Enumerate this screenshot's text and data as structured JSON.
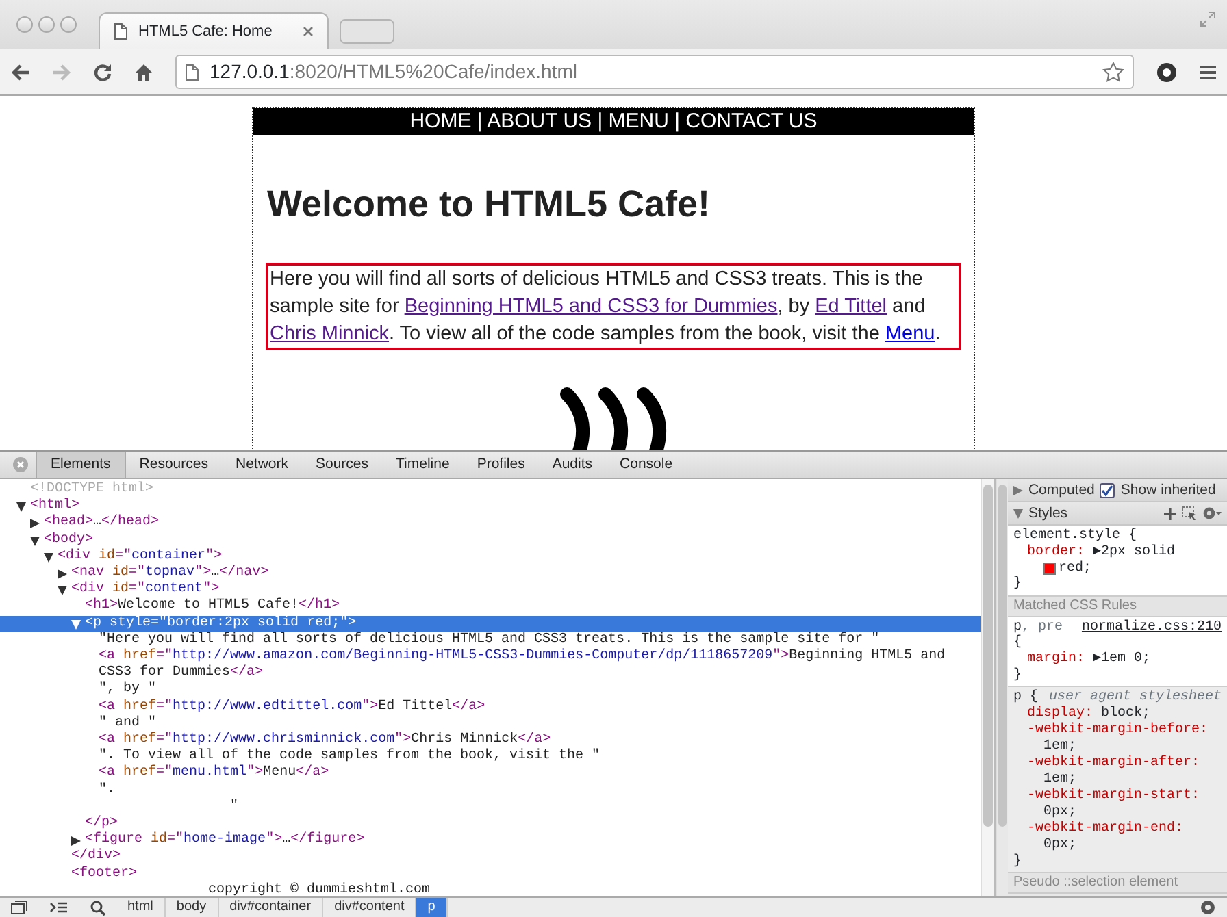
{
  "window": {
    "tab_title": "HTML5 Cafe: Home",
    "nav_buttons": [
      {
        "kind": "back",
        "disabled": false
      },
      {
        "kind": "forward",
        "disabled": true
      }
    ],
    "url_host": "127.0.0.1",
    "url_path": ":8020/HTML5%20Cafe/index.html"
  },
  "page": {
    "nav": "HOME | ABOUT US | MENU | CONTACT US",
    "heading": "Welcome to HTML5 Cafe!",
    "paragraph": [
      {
        "kind": "text",
        "text": "Here you will find all sorts of delicious HTML5 and CSS3 treats. This is the sample site for "
      },
      {
        "kind": "link",
        "text": "Beginning HTML5 and CSS3 for Dummies",
        "visited": true
      },
      {
        "kind": "text",
        "text": ", by "
      },
      {
        "kind": "link",
        "text": "Ed Tittel",
        "visited": true
      },
      {
        "kind": "text",
        "text": " and "
      },
      {
        "kind": "link",
        "text": "Chris Minnick",
        "visited": true
      },
      {
        "kind": "text",
        "text": ". To view all of the code samples from the book, visit the "
      },
      {
        "kind": "link",
        "text": "Menu",
        "visited": false
      },
      {
        "kind": "text",
        "text": "."
      }
    ]
  },
  "devtools": {
    "tabs": [
      {
        "label": "Elements",
        "selected": true
      },
      {
        "label": "Resources",
        "selected": false
      },
      {
        "label": "Network",
        "selected": false
      },
      {
        "label": "Sources",
        "selected": false
      },
      {
        "label": "Timeline",
        "selected": false
      },
      {
        "label": "Profiles",
        "selected": false
      },
      {
        "label": "Audits",
        "selected": false
      },
      {
        "label": "Console",
        "selected": false
      }
    ],
    "dom": [
      {
        "parts": [
          {
            "kind": "doctype",
            "text": "<!DOCTYPE html>"
          }
        ],
        "selected": false
      },
      {
        "parts": [
          {
            "kind": "tag",
            "text": "<html>"
          }
        ],
        "expanded": true,
        "selected": false,
        "children": [
          {
            "parts": [
              {
                "kind": "tag",
                "text": "<head>"
              },
              {
                "kind": "text",
                "text": "…"
              },
              {
                "kind": "tag",
                "text": "</head>"
              }
            ],
            "expanded": false,
            "selected": false
          },
          {
            "parts": [
              {
                "kind": "tag",
                "text": "<body>"
              }
            ],
            "expanded": true,
            "selected": false,
            "children": [
              {
                "parts": [
                  {
                    "kind": "tag",
                    "text": "<div "
                  },
                  {
                    "kind": "attr",
                    "text": "id"
                  },
                  {
                    "kind": "tag",
                    "text": "=\""
                  },
                  {
                    "kind": "value",
                    "text": "container"
                  },
                  {
                    "kind": "tag",
                    "text": "\">"
                  }
                ],
                "expanded": true,
                "selected": false,
                "children": [
                  {
                    "parts": [
                      {
                        "kind": "tag",
                        "text": "<nav "
                      },
                      {
                        "kind": "attr",
                        "text": "id"
                      },
                      {
                        "kind": "tag",
                        "text": "=\""
                      },
                      {
                        "kind": "value",
                        "text": "topnav"
                      },
                      {
                        "kind": "tag",
                        "text": "\">"
                      },
                      {
                        "kind": "text",
                        "text": "…"
                      },
                      {
                        "kind": "tag",
                        "text": "</nav>"
                      }
                    ],
                    "expanded": false,
                    "selected": false
                  },
                  {
                    "parts": [
                      {
                        "kind": "tag",
                        "text": "<div "
                      },
                      {
                        "kind": "attr",
                        "text": "id"
                      },
                      {
                        "kind": "tag",
                        "text": "=\""
                      },
                      {
                        "kind": "value",
                        "text": "content"
                      },
                      {
                        "kind": "tag",
                        "text": "\">"
                      }
                    ],
                    "expanded": true,
                    "selected": false,
                    "children": [
                      {
                        "parts": [
                          {
                            "kind": "tag",
                            "text": "<h1>"
                          },
                          {
                            "kind": "text",
                            "text": "Welcome to HTML5 Cafe!"
                          },
                          {
                            "kind": "tag",
                            "text": "</h1>"
                          }
                        ],
                        "selected": false
                      },
                      {
                        "parts": [
                          {
                            "kind": "tag",
                            "text": "<p "
                          },
                          {
                            "kind": "attr",
                            "text": "style"
                          },
                          {
                            "kind": "tag",
                            "text": "=\""
                          },
                          {
                            "kind": "value",
                            "text": "border:2px solid red;"
                          },
                          {
                            "kind": "tag",
                            "text": "\">"
                          }
                        ],
                        "expanded": true,
                        "selected": true,
                        "children": [
                          {
                            "parts": [
                              {
                                "kind": "text",
                                "text": "\"Here you will find all sorts of delicious HTML5 and CSS3 treats. This is the sample site for \""
                              }
                            ],
                            "selected": false
                          },
                          {
                            "parts": [
                              {
                                "kind": "tag",
                                "text": "<a "
                              },
                              {
                                "kind": "attr",
                                "text": "href"
                              },
                              {
                                "kind": "tag",
                                "text": "=\""
                              },
                              {
                                "kind": "value",
                                "text": "http://www.amazon.com/Beginning-HTML5-CSS3-Dummies-Computer/dp/1118657209"
                              },
                              {
                                "kind": "tag",
                                "text": "\">"
                              },
                              {
                                "kind": "text",
                                "text": "Beginning HTML5 and CSS3 for Dummies"
                              },
                              {
                                "kind": "tag",
                                "text": "</a>"
                              }
                            ],
                            "selected": false
                          },
                          {
                            "parts": [
                              {
                                "kind": "text",
                                "text": "\", by \""
                              }
                            ],
                            "selected": false
                          },
                          {
                            "parts": [
                              {
                                "kind": "tag",
                                "text": "<a "
                              },
                              {
                                "kind": "attr",
                                "text": "href"
                              },
                              {
                                "kind": "tag",
                                "text": "=\""
                              },
                              {
                                "kind": "value",
                                "text": "http://www.edtittel.com"
                              },
                              {
                                "kind": "tag",
                                "text": "\">"
                              },
                              {
                                "kind": "text",
                                "text": "Ed Tittel"
                              },
                              {
                                "kind": "tag",
                                "text": "</a>"
                              }
                            ],
                            "selected": false
                          },
                          {
                            "parts": [
                              {
                                "kind": "text",
                                "text": "\" and \""
                              }
                            ],
                            "selected": false
                          },
                          {
                            "parts": [
                              {
                                "kind": "tag",
                                "text": "<a "
                              },
                              {
                                "kind": "attr",
                                "text": "href"
                              },
                              {
                                "kind": "tag",
                                "text": "=\""
                              },
                              {
                                "kind": "value",
                                "text": "http://www.chrisminnick.com"
                              },
                              {
                                "kind": "tag",
                                "text": "\">"
                              },
                              {
                                "kind": "text",
                                "text": "Chris Minnick"
                              },
                              {
                                "kind": "tag",
                                "text": "</a>"
                              }
                            ],
                            "selected": false
                          },
                          {
                            "parts": [
                              {
                                "kind": "text",
                                "text": "\". To view all of the code samples from the book, visit the \""
                              }
                            ],
                            "selected": false
                          },
                          {
                            "parts": [
                              {
                                "kind": "tag",
                                "text": "<a "
                              },
                              {
                                "kind": "attr",
                                "text": "href"
                              },
                              {
                                "kind": "tag",
                                "text": "=\""
                              },
                              {
                                "kind": "value",
                                "text": "menu.html"
                              },
                              {
                                "kind": "tag",
                                "text": "\">"
                              },
                              {
                                "kind": "text",
                                "text": "Menu"
                              },
                              {
                                "kind": "tag",
                                "text": "</a>"
                              }
                            ],
                            "selected": false
                          },
                          {
                            "parts": [
                              {
                                "kind": "text",
                                "text": "\".\n                \""
                              }
                            ],
                            "selected": false
                          }
                        ],
                        "closing": [
                          {
                            "kind": "tag",
                            "text": "</p>"
                          }
                        ]
                      },
                      {
                        "parts": [
                          {
                            "kind": "tag",
                            "text": "<figure "
                          },
                          {
                            "kind": "attr",
                            "text": "id"
                          },
                          {
                            "kind": "tag",
                            "text": "=\""
                          },
                          {
                            "kind": "value",
                            "text": "home-image"
                          },
                          {
                            "kind": "tag",
                            "text": "\">"
                          },
                          {
                            "kind": "text",
                            "text": "…"
                          },
                          {
                            "kind": "tag",
                            "text": "</figure>"
                          }
                        ],
                        "expanded": false,
                        "selected": false
                      }
                    ],
                    "closing": [
                      {
                        "kind": "tag",
                        "text": "</div>"
                      }
                    ]
                  },
                  {
                    "parts": [
                      {
                        "kind": "tag",
                        "text": "<footer>"
                      }
                    ],
                    "selected": false,
                    "children": [
                      {
                        "parts": [
                          {
                            "kind": "text",
                            "text": "               copyright © dummieshtml.com"
                          }
                        ],
                        "selected": false
                      }
                    ]
                  }
                ]
              }
            ]
          }
        ]
      }
    ],
    "breadcrumbs": [
      {
        "label": "html",
        "selected": false
      },
      {
        "label": "body",
        "selected": false
      },
      {
        "label": "div#container",
        "selected": false
      },
      {
        "label": "div#content",
        "selected": false
      },
      {
        "label": "p",
        "selected": true
      }
    ],
    "styles": {
      "computed": {
        "label": "Computed",
        "expanded": false
      },
      "show_inherited": {
        "label": "Show inherited",
        "checked": true
      },
      "styles_pane": {
        "label": "Styles",
        "expanded": true
      },
      "sections": [
        {
          "kind": "rule",
          "selector": "element.style {",
          "user_agent": false,
          "properties": [
            {
              "name": "border:",
              "value": "▶2px solid",
              "color": "#ff0000",
              "tail": "red;"
            }
          ],
          "close": "}"
        },
        {
          "kind": "header",
          "label": "Matched CSS Rules"
        },
        {
          "kind": "rule",
          "selector": "p",
          "selector_dim": ", pre",
          "source": "normalize.css:210",
          "open": "{",
          "user_agent": false,
          "properties": [
            {
              "name": "margin:",
              "value": "▶1em 0;"
            }
          ],
          "close": "}"
        },
        {
          "kind": "rule",
          "selector": "p {",
          "origin": "user agent stylesheet",
          "user_agent": true,
          "properties": [
            {
              "name": "display:",
              "value": "block;"
            },
            {
              "name": "-webkit-margin-before:",
              "value": "1em;"
            },
            {
              "name": "-webkit-margin-after:",
              "value": "1em;"
            },
            {
              "name": "-webkit-margin-start:",
              "value": "0px;"
            },
            {
              "name": "-webkit-margin-end:",
              "value": "0px;"
            }
          ],
          "close": "}"
        },
        {
          "kind": "header",
          "label": "Pseudo ::selection element"
        }
      ]
    }
  }
}
